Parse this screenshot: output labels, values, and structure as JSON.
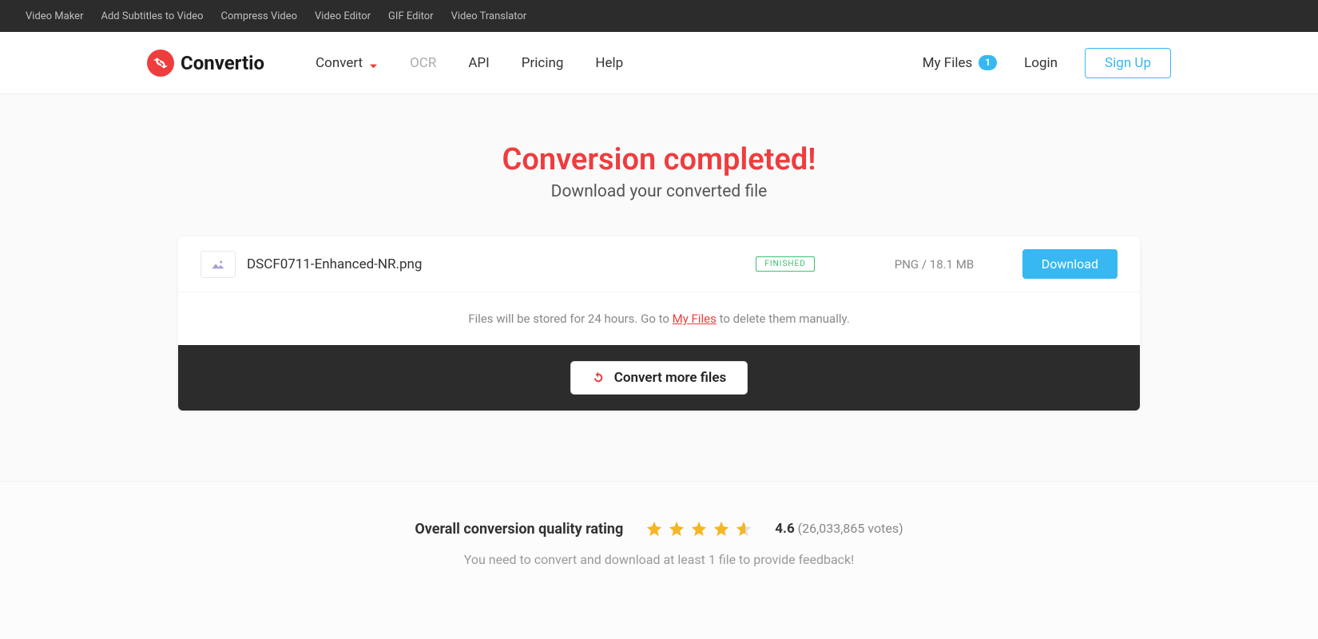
{
  "topbar": {
    "links": [
      "Video Maker",
      "Add Subtitles to Video",
      "Compress Video",
      "Video Editor",
      "GIF Editor",
      "Video Translator"
    ]
  },
  "brand": {
    "name": "Convertio"
  },
  "nav": {
    "convert": "Convert",
    "ocr": "OCR",
    "api": "API",
    "pricing": "Pricing",
    "help": "Help",
    "myfiles": "My Files",
    "myfiles_count": "1",
    "login": "Login",
    "signup": "Sign Up"
  },
  "headline": {
    "title": "Conversion completed!",
    "subtitle": "Download your converted file"
  },
  "file": {
    "name": "DSCF0711-Enhanced-NR.png",
    "status": "FINISHED",
    "meta": "PNG / 18.1 MB",
    "download": "Download"
  },
  "storage": {
    "prefix": "Files will be stored for 24 hours. Go to ",
    "link": "My Files",
    "suffix": " to delete them manually."
  },
  "convert_more": "Convert more files",
  "rating": {
    "label": "Overall conversion quality rating",
    "score": "4.6",
    "votes": "(26,033,865 votes)",
    "note": "You need to convert and download at least 1 file to provide feedback!"
  },
  "colors": {
    "accent_red": "#ef3c3d",
    "accent_blue": "#38b8f2",
    "star": "#f5b623"
  }
}
